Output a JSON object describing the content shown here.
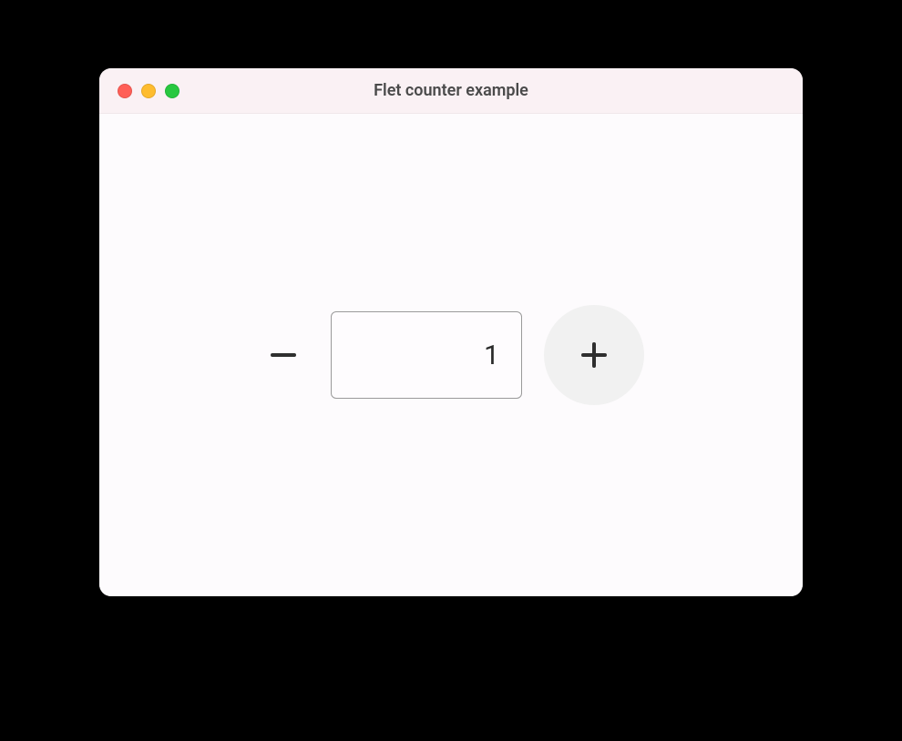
{
  "window": {
    "title": "Flet counter example"
  },
  "counter": {
    "value": "1"
  },
  "traffic_lights": {
    "close_color": "#ff5f57",
    "minimize_color": "#febc2e",
    "zoom_color": "#28c840"
  }
}
